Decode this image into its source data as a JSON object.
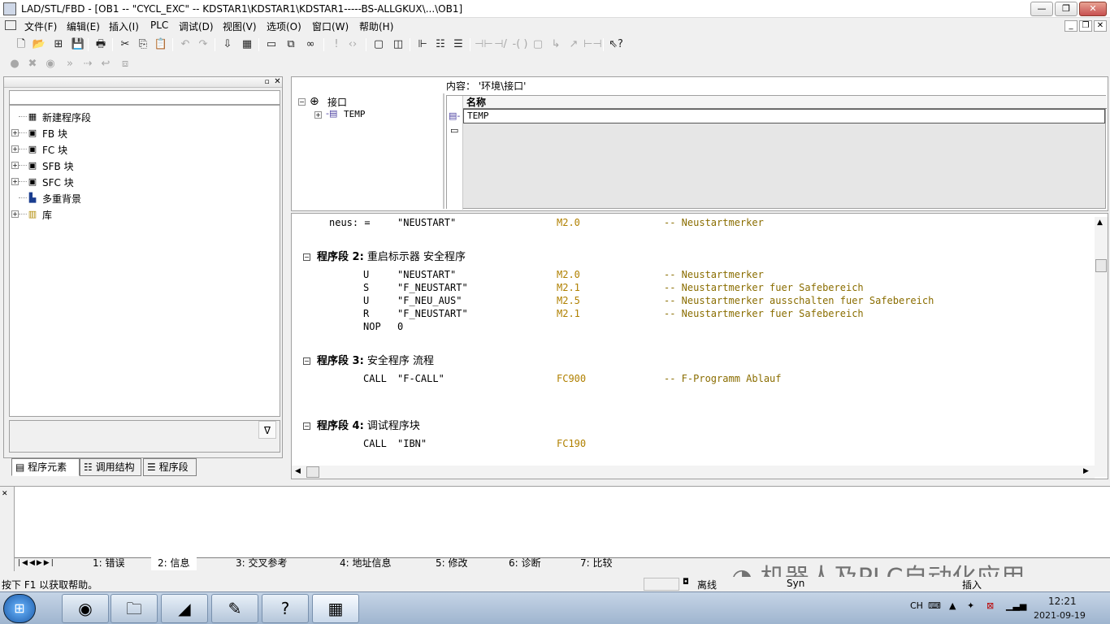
{
  "window": {
    "title": "LAD/STL/FBD  - [OB1 -- \"CYCL_EXC\" -- KDSTAR1\\KDSTAR1\\KDSTAR1-----BS-ALLGKUX\\...\\OB1]",
    "minimize": "—",
    "restore": "❐",
    "close": "✕"
  },
  "menu": {
    "items": [
      "文件(F)",
      "编辑(E)",
      "插入(I)",
      "PLC",
      "调试(D)",
      "视图(V)",
      "选项(O)",
      "窗口(W)",
      "帮助(H)"
    ]
  },
  "left_panel": {
    "tree": [
      {
        "label": "新建程序段",
        "icon": "network-icon"
      },
      {
        "label": "FB 块",
        "icon": "block-icon"
      },
      {
        "label": "FC 块",
        "icon": "block-icon"
      },
      {
        "label": "SFB 块",
        "icon": "block-icon"
      },
      {
        "label": "SFC 块",
        "icon": "block-icon"
      },
      {
        "label": "多重背景",
        "icon": "multi-instance-icon"
      },
      {
        "label": "库",
        "icon": "library-icon"
      }
    ],
    "tabs": [
      "程序元素",
      "调用结构",
      "程序段"
    ]
  },
  "interface": {
    "tree_root": "接口",
    "tree_child": "TEMP",
    "content_label": "内容：  '环境\\接口'",
    "column_name": "名称",
    "row_value": "TEMP"
  },
  "code": {
    "line0": {
      "text": "neus: =",
      "symbol": "\"NEUSTART\"",
      "addr": "M2.0",
      "comment": "-- Neustartmerker"
    },
    "networks": [
      {
        "title": "程序段 2:",
        "desc": "重启标示器 安全程序",
        "lines": [
          {
            "op": "U",
            "symbol": "\"NEUSTART\"",
            "addr": "M2.0",
            "comment": "-- Neustartmerker"
          },
          {
            "op": "S",
            "symbol": "\"F_NEUSTART\"",
            "addr": "M2.1",
            "comment": "-- Neustartmerker fuer Safebereich"
          },
          {
            "op": "U",
            "symbol": "\"F_NEU_AUS\"",
            "addr": "M2.5",
            "comment": "-- Neustartmerker ausschalten fuer Safebereich"
          },
          {
            "op": "R",
            "symbol": "\"F_NEUSTART\"",
            "addr": "M2.1",
            "comment": "-- Neustartmerker fuer Safebereich"
          },
          {
            "op": "NOP",
            "symbol": "0",
            "addr": "",
            "comment": ""
          }
        ]
      },
      {
        "title": "程序段 3:",
        "desc": "安全程序 流程",
        "lines": [
          {
            "op": "CALL",
            "symbol": "\"F-CALL\"",
            "addr": "FC900",
            "comment": "-- F-Programm Ablauf"
          }
        ]
      },
      {
        "title": "程序段 4:",
        "desc": "调试程序块",
        "lines": [
          {
            "op": "CALL",
            "symbol": "\"IBN\"",
            "addr": "FC190",
            "comment": ""
          }
        ]
      }
    ]
  },
  "info_tabs": [
    "1: 错误",
    "2: 信息",
    "3: 交叉参考",
    "4: 地址信息",
    "5: 修改",
    "6: 诊断",
    "7: 比较"
  ],
  "status": {
    "help": "按下 F1 以获取帮助。",
    "offline": "离线",
    "sym": "Syn",
    "insert": "插入"
  },
  "watermark": "机器人及PLC自动化应用",
  "taskbar": {
    "lang": "CH",
    "time": "12:21",
    "date": "2021-09-19"
  }
}
